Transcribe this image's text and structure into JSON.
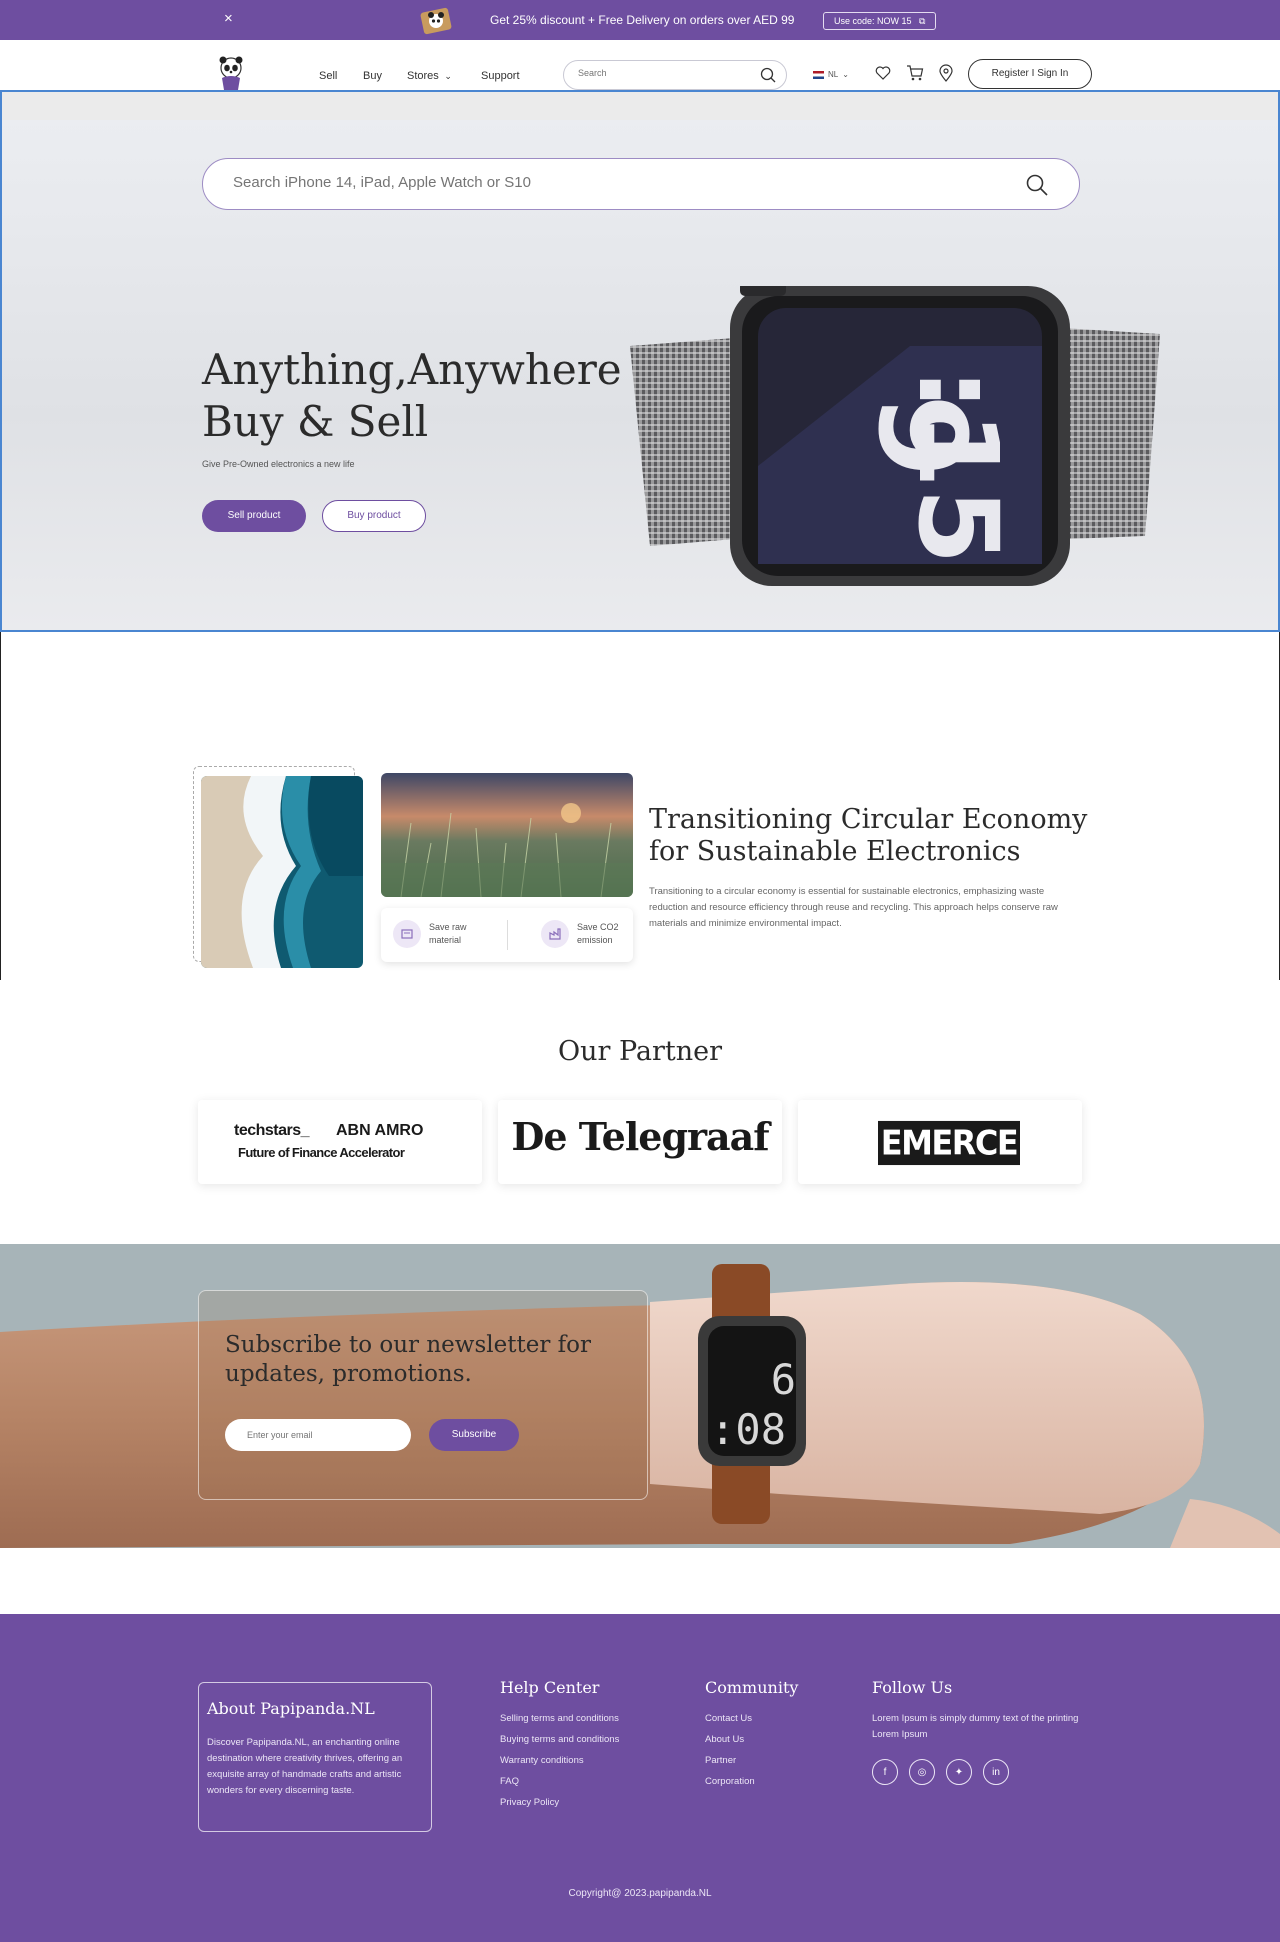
{
  "promo": {
    "message": "Get 25% discount + Free Delivery on orders over AED 99",
    "code_label": "Use code: NOW 15",
    "close_glyph": "×"
  },
  "nav": {
    "links": [
      "Sell",
      "Buy",
      "Stores",
      "Support"
    ],
    "search_placeholder": "Search",
    "language": "NL",
    "register_label": "Register I Sign In"
  },
  "hero": {
    "search_placeholder": "Search iPhone 14, iPad, Apple Watch or S10",
    "title_line1": "Anything,Anywhere",
    "title_line2": "Buy & Sell",
    "tagline": "Give Pre-Owned electronics a new life",
    "sell_label": "Sell  product",
    "buy_label": "Buy  product",
    "watch_hour": "9",
    "watch_minute": ":15"
  },
  "circular": {
    "title": "Transitioning Circular Economy for Sustainable Electronics",
    "body": "Transitioning to a circular economy is essential for sustainable electronics, emphasizing waste reduction and resource efficiency through reuse and recycling. This approach helps conserve raw materials and minimize environmental impact.",
    "stat1_label": "Save raw material",
    "stat2_label": "Save CO2 emission"
  },
  "partners": {
    "title": "Our Partner",
    "techstars": "techstars_",
    "abnamro": "ABN AMRO",
    "techstars_sub": "Future of Finance Accelerator",
    "telegraaf": "De Telegraaf",
    "emerce": "EMERCE"
  },
  "newsletter": {
    "title": "Subscribe to our newsletter for updates, promotions.",
    "email_placeholder": "Enter your email",
    "subscribe_label": "Subscribe",
    "watch_hour": "6",
    "watch_minute": ":08"
  },
  "footer": {
    "about_title": "About Papipanda.NL",
    "about_text": "Discover Papipanda.NL, an enchanting online destination where creativity thrives, offering an exquisite array of handmade crafts and artistic wonders for every discerning taste.",
    "help_title": "Help Center",
    "help_links": [
      "Selling terms and conditions",
      "Buying terms and conditions",
      "Warranty conditions",
      "FAQ",
      "Privacy Policy"
    ],
    "community_title": "Community",
    "community_links": [
      "Contact Us",
      "About Us",
      "Partner",
      "Corporation"
    ],
    "follow_title": "Follow Us",
    "follow_text": "Lorem Ipsum is simply dummy text of the printing Lorem Ipsum",
    "social_icons": [
      "facebook-icon",
      "instagram-icon",
      "twitter-icon",
      "linkedin-icon"
    ],
    "copyright": "Copyright@ 2023.papipanda.NL"
  },
  "colors": {
    "brand": "#6e4ea0",
    "link_border": "#4a86d1"
  }
}
